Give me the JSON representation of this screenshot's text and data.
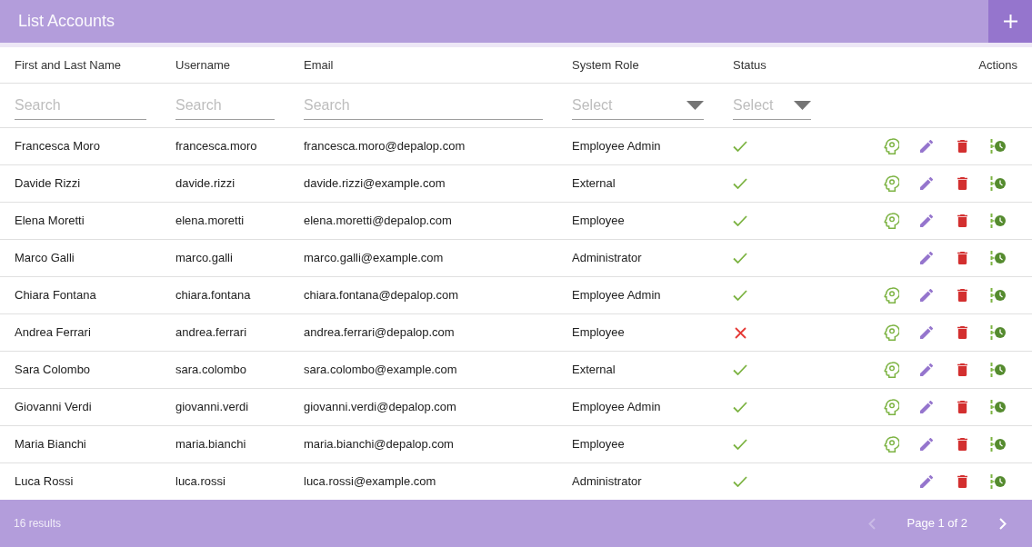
{
  "header": {
    "title": "List Accounts"
  },
  "table": {
    "columns": [
      {
        "label": "First and Last Name",
        "filter": {
          "kind": "search",
          "placeholder": "Search"
        }
      },
      {
        "label": "Username",
        "filter": {
          "kind": "search",
          "placeholder": "Search"
        }
      },
      {
        "label": "Email",
        "filter": {
          "kind": "search",
          "placeholder": "Search"
        }
      },
      {
        "label": "System Role",
        "filter": {
          "kind": "select",
          "placeholder": "Select"
        }
      },
      {
        "label": "Status",
        "filter": {
          "kind": "select",
          "placeholder": "Select"
        }
      },
      {
        "label": "Actions"
      }
    ],
    "rows": [
      {
        "name": "Francesca Moro",
        "username": "francesca.moro",
        "email": "francesca.moro@depalop.com",
        "role": "Employee Admin",
        "active": true,
        "profile_action": true
      },
      {
        "name": "Davide Rizzi",
        "username": "davide.rizzi",
        "email": "davide.rizzi@example.com",
        "role": "External",
        "active": true,
        "profile_action": true
      },
      {
        "name": "Elena Moretti",
        "username": "elena.moretti",
        "email": "elena.moretti@depalop.com",
        "role": "Employee",
        "active": true,
        "profile_action": true
      },
      {
        "name": "Marco Galli",
        "username": "marco.galli",
        "email": "marco.galli@example.com",
        "role": "Administrator",
        "active": true,
        "profile_action": false
      },
      {
        "name": "Chiara Fontana",
        "username": "chiara.fontana",
        "email": "chiara.fontana@depalop.com",
        "role": "Employee Admin",
        "active": true,
        "profile_action": true
      },
      {
        "name": "Andrea Ferrari",
        "username": "andrea.ferrari",
        "email": "andrea.ferrari@depalop.com",
        "role": "Employee",
        "active": false,
        "profile_action": true
      },
      {
        "name": "Sara Colombo",
        "username": "sara.colombo",
        "email": "sara.colombo@example.com",
        "role": "External",
        "active": true,
        "profile_action": true
      },
      {
        "name": "Giovanni Verdi",
        "username": "giovanni.verdi",
        "email": "giovanni.verdi@depalop.com",
        "role": "Employee Admin",
        "active": true,
        "profile_action": true
      },
      {
        "name": "Maria Bianchi",
        "username": "maria.bianchi",
        "email": "maria.bianchi@depalop.com",
        "role": "Employee",
        "active": true,
        "profile_action": true
      },
      {
        "name": "Luca Rossi",
        "username": "luca.rossi",
        "email": "luca.rossi@example.com",
        "role": "Administrator",
        "active": true,
        "profile_action": false
      }
    ]
  },
  "footer": {
    "results": "16 results",
    "page": "Page 1 of 2",
    "prev_disabled": true,
    "next_disabled": false
  }
}
